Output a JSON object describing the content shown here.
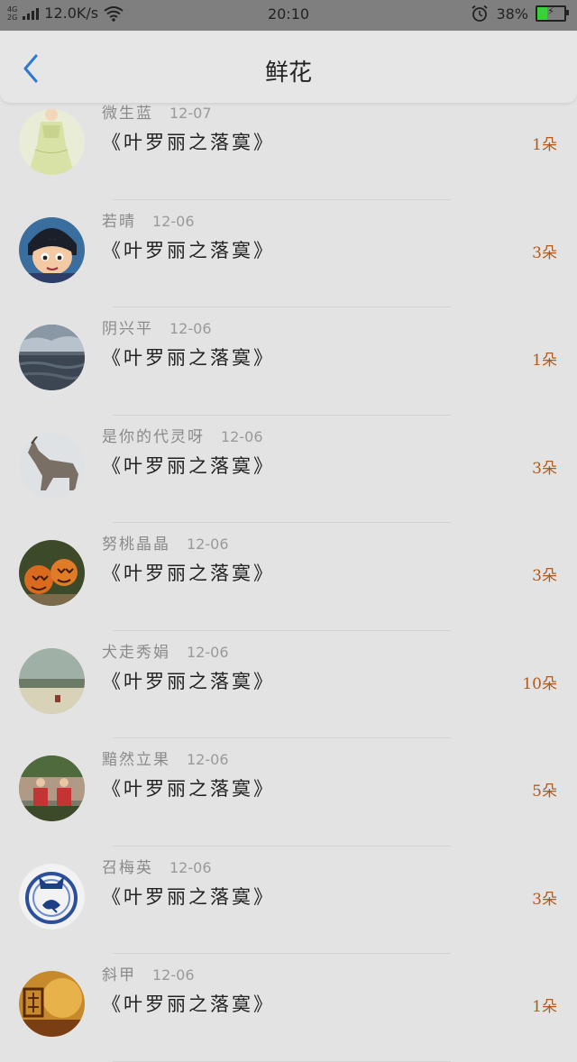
{
  "status_bar": {
    "net_top": "4G",
    "net_bottom": "2G",
    "speed": "12.0K/s",
    "time": "20:10",
    "battery": "38%",
    "battery_level": 0.38
  },
  "header": {
    "title": "鲜花",
    "back_icon": "chevron-left-icon"
  },
  "items": [
    {
      "name": "微生蓝",
      "date": "12-07",
      "book": "《叶罗丽之落寞》",
      "count": "1朵",
      "avatar": "girl-dress"
    },
    {
      "name": "若晴",
      "date": "12-06",
      "book": "《叶罗丽之落寞》",
      "count": "3朵",
      "avatar": "anime-boy"
    },
    {
      "name": "阴兴平",
      "date": "12-06",
      "book": "《叶罗丽之落寞》",
      "count": "1朵",
      "avatar": "ocean-clouds"
    },
    {
      "name": "是你的代灵呀",
      "date": "12-06",
      "book": "《叶罗丽之落寞》",
      "count": "3朵",
      "avatar": "wolf"
    },
    {
      "name": "努桃晶晶",
      "date": "12-06",
      "book": "《叶罗丽之落寞》",
      "count": "3朵",
      "avatar": "pumpkins"
    },
    {
      "name": "犬走秀娟",
      "date": "12-06",
      "book": "《叶罗丽之落寞》",
      "count": "10朵",
      "avatar": "landscape"
    },
    {
      "name": "黯然立果",
      "date": "12-06",
      "book": "《叶罗丽之落寞》",
      "count": "5朵",
      "avatar": "two-people"
    },
    {
      "name": "召梅英",
      "date": "12-06",
      "book": "《叶罗丽之落寞》",
      "count": "3朵",
      "avatar": "tiger-emblem"
    },
    {
      "name": "斜甲",
      "date": "12-06",
      "book": "《叶罗丽之落寞》",
      "count": "1朵",
      "avatar": "golden-poster"
    }
  ]
}
